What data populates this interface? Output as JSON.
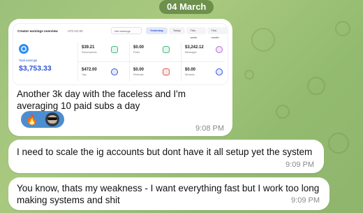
{
  "date_label": "04 March",
  "messages": [
    {
      "text": "Another 3k day with the faceless and I'm averaging 10 paid subs a day",
      "time": "9:08 PM",
      "reaction_emoji": "🔥",
      "screenshot": {
        "title": "Creator earnings overview",
        "timezone": "UTC+01:00",
        "select_value": "Net earnings",
        "tabs": [
          "Yesterday",
          "Today",
          "This week",
          "This month"
        ],
        "active_tab": "Yesterday",
        "total_label": "Total earnings",
        "total_value": "$3,753.33",
        "stats": [
          {
            "value": "$39.21",
            "label": "Subscriptions",
            "icon": "subscription-icon",
            "color": "#4cb782"
          },
          {
            "value": "$0.00",
            "label": "Posts",
            "icon": "post-icon",
            "color": "#4cb782"
          },
          {
            "value": "$3,242.12",
            "label": "Messages",
            "icon": "message-icon",
            "color": "#b06ad8"
          },
          {
            "value": "$472.00",
            "label": "Tips",
            "icon": "tip-icon",
            "color": "#2f55d4"
          },
          {
            "value": "$0.00",
            "label": "Referrals",
            "icon": "referral-icon",
            "color": "#e0554f"
          },
          {
            "value": "$0.00",
            "label": "Streams",
            "icon": "stream-icon",
            "color": "#2f55d4"
          }
        ]
      }
    },
    {
      "text": "I need to scale the ig accounts but dont have it all setup yet the system",
      "time": "9:09 PM"
    },
    {
      "text": "You know, thats my weakness - I want everything fast but I work too long making systems and shit",
      "time": "9:09 PM"
    }
  ],
  "colors": {
    "accent_blue": "#2f55d4",
    "reaction_bg": "#4c8ed0",
    "date_pill_bg": "#5a7d3c"
  }
}
